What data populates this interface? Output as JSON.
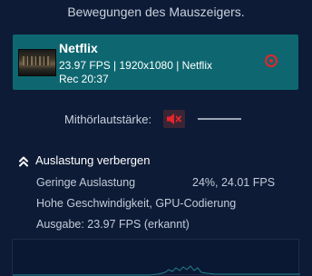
{
  "hint": "Bewegungen des Mauszeigers.",
  "source": {
    "title": "Netflix",
    "meta": "23.97 FPS | 1920x1080 | Netflix",
    "rec": "Rec 20:37"
  },
  "audio": {
    "monitor_label": "Mithörlautstärke:"
  },
  "stats": {
    "toggle_label": "Auslastung verbergen",
    "load_label": "Geringe Auslastung",
    "load_value": "24%, 24.01 FPS",
    "mode": "Hohe Geschwindigkeit, GPU-Codierung",
    "output": "Ausgabe: 23.97 FPS (erkannt)"
  },
  "colors": {
    "background": "#0d1b36",
    "card": "#0e6770",
    "record": "#e5252a",
    "graph_line": "#1e7f8a"
  }
}
